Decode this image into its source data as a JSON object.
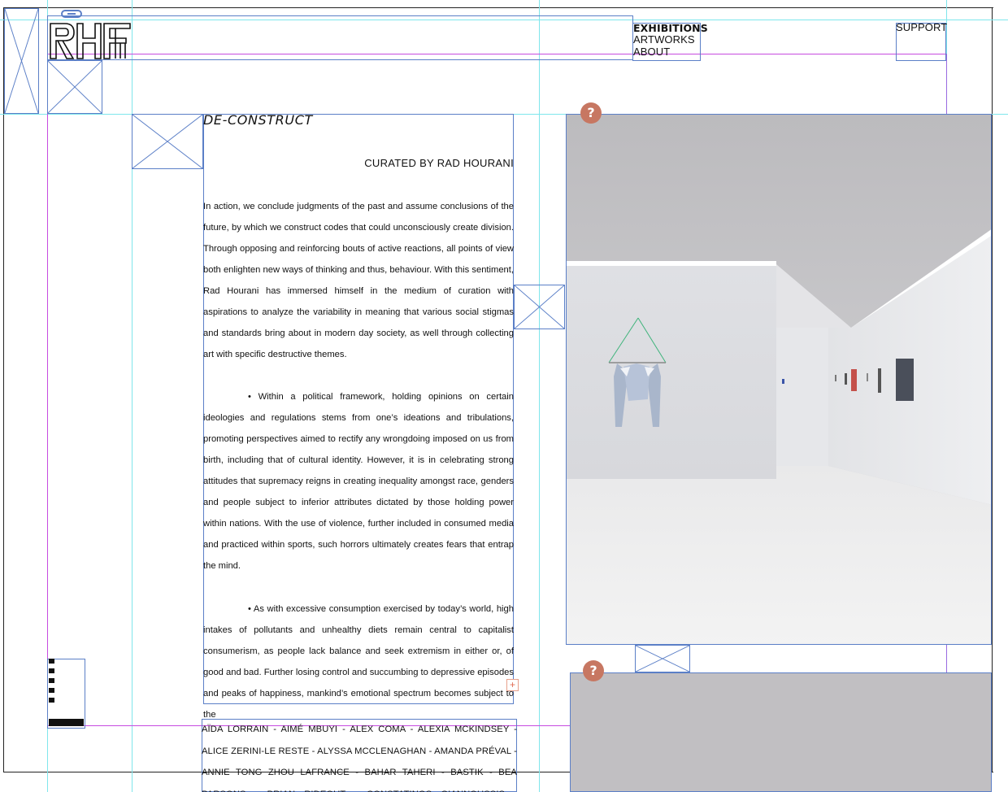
{
  "header": {
    "logo_text": "RHF",
    "nav": {
      "exhibitions": "EXHIBITIONS",
      "artworks": "ARTWORKS",
      "about": "ABOUT",
      "support": "SUPPORT"
    }
  },
  "exhibition": {
    "title": "DE-CONSTRUCT",
    "curator": "CURATED BY RAD HOURANI",
    "intro": "In action, we conclude judgments of the past and assume conclusions of the future, by which we construct codes that could unconsciously create division. Through opposing and reinforcing bouts of active reactions, all points of view both enlighten new ways of thinking and thus, behaviour. With this sentiment, Rad Hourani has immersed himself in the medium of curation with aspirations to analyze the variability in meaning that various social stigmas and standards bring about in modern day society, as well through collecting art with specific destructive themes.",
    "point_1": "• Within a political framework, holding opinions on certain ideologies and regulations stems from one’s ideations and tribulations, promoting perspectives aimed to rectify any wrongdoing imposed on us from birth, including that of cultural identity. However, it is in celebrating strong attitudes that supremacy reigns in creating inequality amongst race, genders and people subject to inferior attributes dictated by those holding power within nations. With the use of violence, further included in consumed media and practiced within sports, such horrors ultimately creates fears that entrap the mind.",
    "point_2": "• As with excessive consumption exercised by today’s world, high intakes of pollutants and unhealthy diets remain central to capitalist consumerism, as people lack balance and seek extremism in either or, of good and bad. Further losing control and succumbing to depressive episodes and peaks of happiness, mankind’s emotional spectrum becomes subject to the",
    "artists": "AÏDA LORRAIN - AIMÉ MBUYI - ALEX COMA - ALEXIA MCKINDSEY - ALICE ZERINI-LE RESTE - ALYSSA MCCLENAGHAN - AMANDA PRÉVAL - ANNIE TONG ZHOU LAFRANCE - BAHAR TAHERI - BASTIK - BEA PARSONS - BRIAN RIDEOUT - CONSTATINOS GIANNOUSSIS - DOMINIQUE SIROIS - ELISE"
  },
  "icons": {
    "help": "?"
  },
  "colors": {
    "guide": "#7fe6ec",
    "frame": "#5b7fc7",
    "margin": "#c64be0",
    "help_icon": "#c77762",
    "image_placeholder": "#c1bfc2"
  }
}
